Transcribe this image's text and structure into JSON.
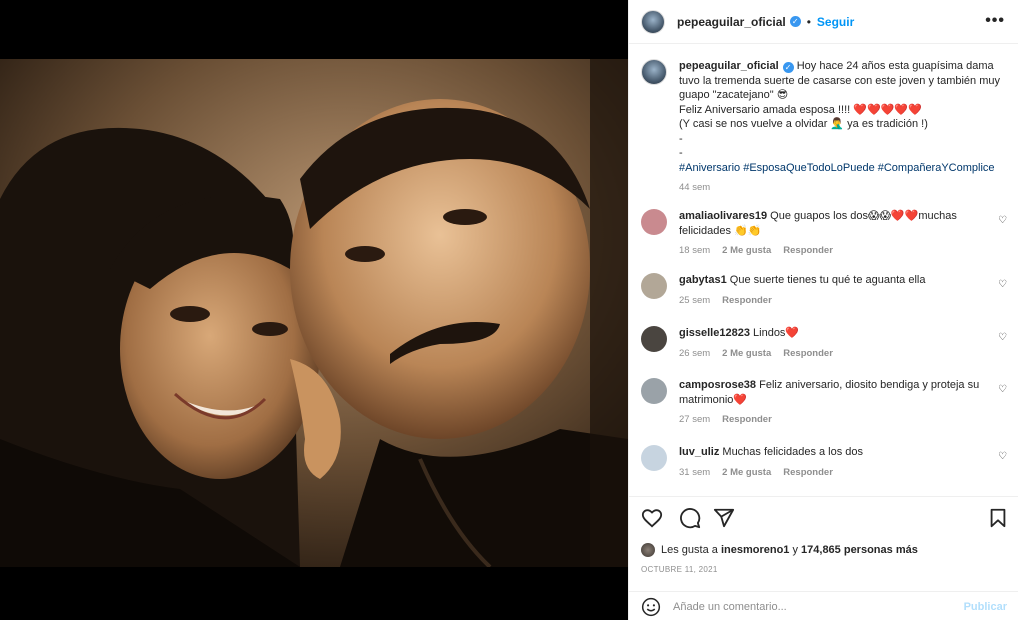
{
  "post": {
    "username": "pepeaguilar_oficial",
    "follow_label": "Seguir",
    "dot": "•",
    "more_label": "•••"
  },
  "caption": {
    "username": "pepeaguilar_oficial",
    "line1": "Hoy hace 24 años esta guapísima dama tuvo la tremenda suerte de casarse con este joven y también muy guapo \"zacatejano\" 😎",
    "line2": "Feliz Aniversario amada esposa !!!! ❤️❤️❤️❤️❤️",
    "line3": "(Y casi se nos vuelve a olvidar 🤦‍♂️ ya es tradición !)",
    "line4": "-",
    "line5": "-",
    "hashtags": "#Aniversario #EsposaQueTodoLoPuede #CompañeraYComplice",
    "time": "44 sem"
  },
  "comments": [
    {
      "username": "amaliaolivares19",
      "text": "Que guapos los dos😱😱❤️❤️muchas felicidades 👏👏",
      "time": "18 sem",
      "likes": "2 Me gusta",
      "reply": "Responder",
      "avatar_color": "#c98a8f"
    },
    {
      "username": "gabytas1",
      "text": "Que suerte tienes tu qué te aguanta ella",
      "time": "25 sem",
      "likes": "",
      "reply": "Responder",
      "avatar_color": "#b2a797"
    },
    {
      "username": "gisselle12823",
      "text": "Lindos❤️",
      "time": "26 sem",
      "likes": "2 Me gusta",
      "reply": "Responder",
      "avatar_color": "#4a4540"
    },
    {
      "username": "camposrose38",
      "text": "Feliz aniversario, diosito bendiga y proteja su matrimonio❤️",
      "time": "27 sem",
      "likes": "",
      "reply": "Responder",
      "avatar_color": "#9aa2a8"
    },
    {
      "username": "luv_uliz",
      "text": "Muchas felicidades a los dos",
      "time": "31 sem",
      "likes": "2 Me gusta",
      "reply": "Responder",
      "avatar_color": "#c7d4e0"
    }
  ],
  "likes_summary": {
    "prefix": "Les gusta a",
    "user": "inesmoreno1",
    "middle": "y",
    "count": "174,865 personas más"
  },
  "date": "OCTUBRE 11, 2021",
  "comment_box": {
    "placeholder": "Añade un comentario...",
    "post_label": "Publicar"
  },
  "icons": [
    "heart-icon",
    "comment-icon",
    "share-icon",
    "bookmark-icon",
    "emoji-icon",
    "verified-icon"
  ]
}
